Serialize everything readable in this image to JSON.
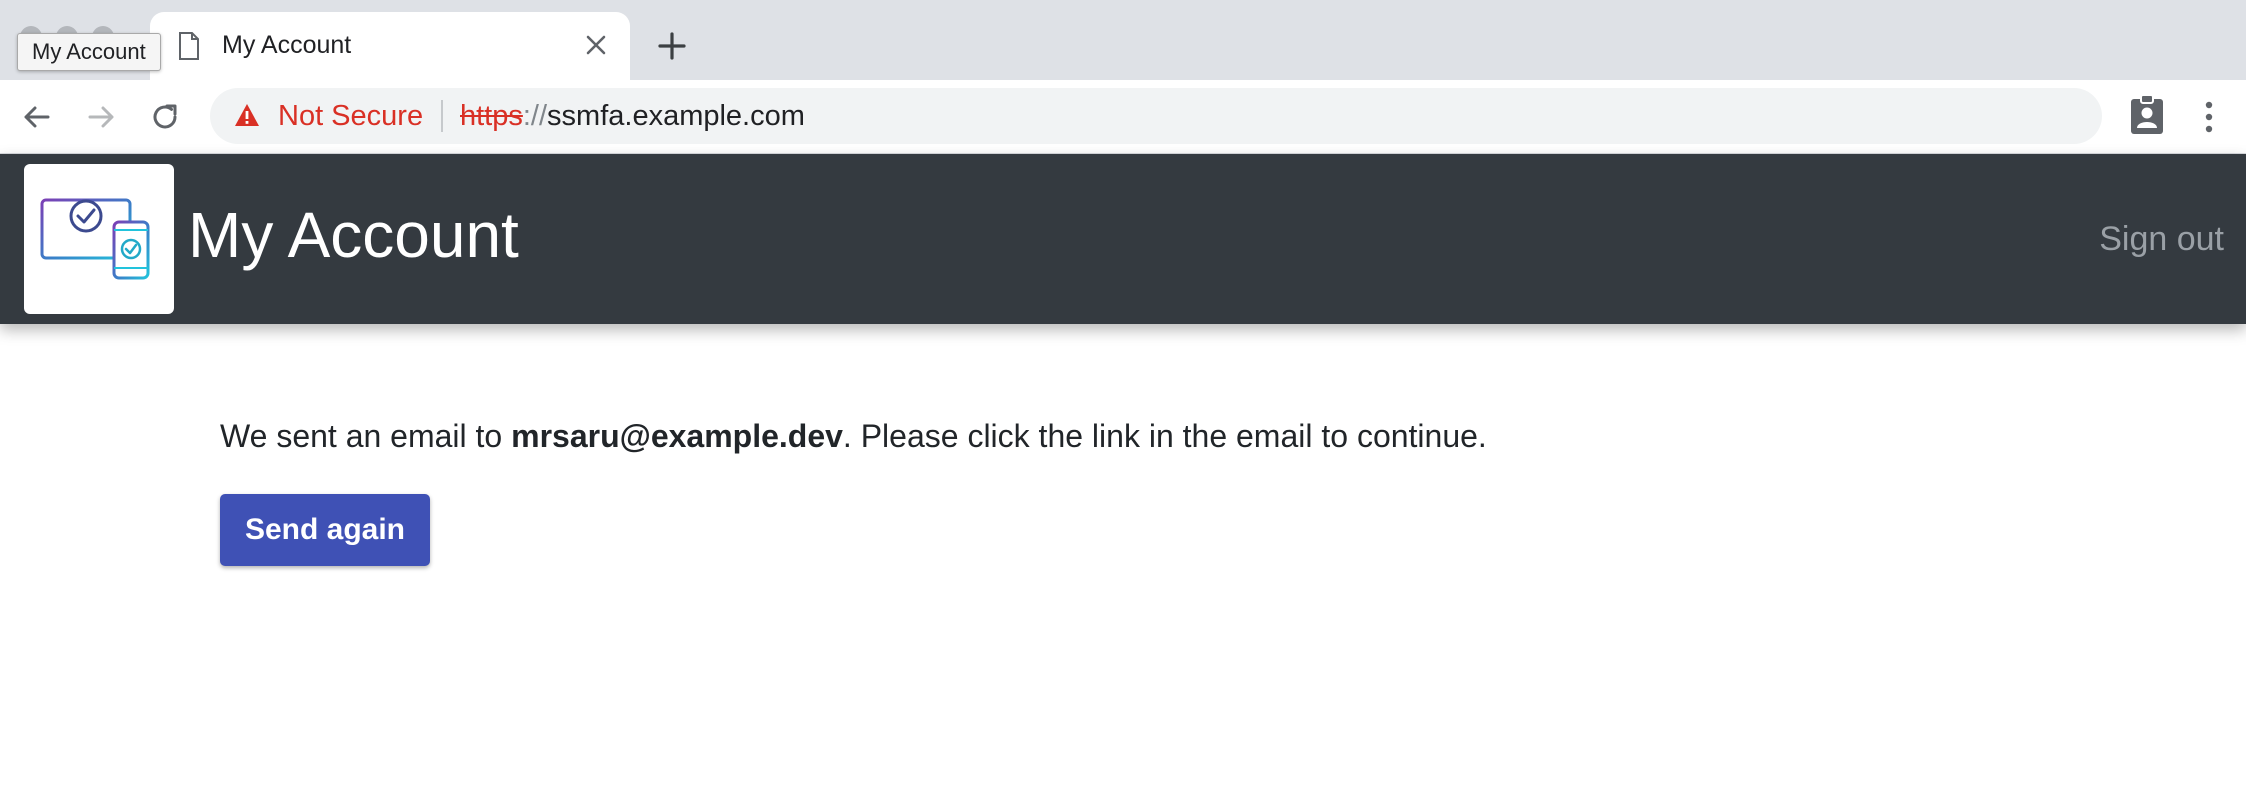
{
  "browser": {
    "tab": {
      "title": "My Account",
      "tooltip": "My Account"
    },
    "address_bar": {
      "security_label": "Not Secure",
      "url_scheme": "https",
      "url_separator": "://",
      "url_host": "ssmfa.example.com"
    },
    "colors": {
      "warning": "#d93025",
      "chrome_bg": "#dee1e6"
    },
    "icons": [
      "back-icon",
      "forward-icon",
      "reload-icon",
      "warning-icon",
      "profile-icon",
      "kebab-menu-icon",
      "page-icon",
      "close-icon",
      "plus-icon"
    ]
  },
  "header": {
    "title": "My Account",
    "sign_out_label": "Sign out",
    "logo_icon": "devices-check-icon",
    "colors": {
      "background": "#343a40"
    }
  },
  "main": {
    "message_prefix": "We sent an email to ",
    "email": "mrsaru@example.dev",
    "message_suffix": ". Please click the link in the email to continue.",
    "send_again_label": "Send again",
    "colors": {
      "button": "#3f51b5"
    }
  }
}
